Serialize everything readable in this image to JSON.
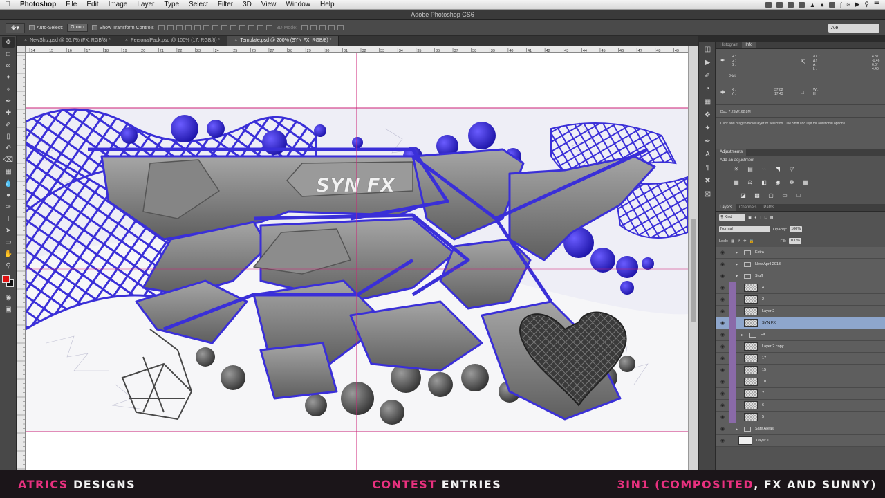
{
  "menubar": {
    "app": "Photoshop",
    "items": [
      "File",
      "Edit",
      "Image",
      "Layer",
      "Type",
      "Select",
      "Filter",
      "3D",
      "View",
      "Window",
      "Help"
    ]
  },
  "window": {
    "title": "Adobe Photoshop CS6"
  },
  "options": {
    "auto_select_label": "Auto-Select:",
    "auto_select_value": "Group",
    "transform_label": "Show Transform Controls",
    "mode_3d": "3D Mode:",
    "workspace": "Ale"
  },
  "tabs": [
    "NewShiz.psd @ 66.7% (FX, RGB/8) *",
    "PersonalPack.psd @ 100% (17, RGB/8) *",
    "Template.psd @ 200% (SYN FX, RGB/8) *"
  ],
  "rulers": {
    "h_ticks": [
      "14",
      "15",
      "16",
      "17",
      "18",
      "19",
      "20",
      "21",
      "22",
      "23",
      "24",
      "25",
      "26",
      "27",
      "28",
      "29",
      "30",
      "31",
      "32",
      "33",
      "34",
      "35",
      "36",
      "37",
      "38",
      "39",
      "40",
      "41",
      "42",
      "43",
      "44",
      "45",
      "46",
      "47",
      "48",
      "49"
    ]
  },
  "artwork": {
    "label": "SYN FX"
  },
  "colors": {
    "accent_blue": "#3a2fd8",
    "guide": "#cc2277",
    "fg": "#e01010",
    "bg": "#111111",
    "banner_pink": "#e8317f"
  },
  "info_panel": {
    "tabs": [
      "Histogram",
      "Info"
    ],
    "rgb_labels": [
      "R :",
      "G :",
      "B :"
    ],
    "bit": "8-bit",
    "delta": {
      "ax_label": "ΔX :",
      "ax": "4.37",
      "ay_label": "ΔY :",
      "ay": "-0.46",
      "a_label": "A :",
      "a": "6.0°",
      "l_label": "L :",
      "l": "4.40"
    },
    "xy": {
      "x_label": "X :",
      "x": "37.82",
      "y_label": "Y :",
      "y": "17.43"
    },
    "wh": {
      "w_label": "W :",
      "h_label": "H :"
    },
    "doc": "Doc: 7.23M/162.8M",
    "hint": "Click and drag to move layer or selection.  Use Shift and Opt for additional options."
  },
  "adjustments": {
    "tab": "Adjustments",
    "header": "Add an adjustment"
  },
  "layers": {
    "tabs": [
      "Layers",
      "Channels",
      "Paths"
    ],
    "kind": "Kind",
    "blend": "Normal",
    "opacity_label": "Opacity:",
    "opacity": "100%",
    "lock_label": "Lock:",
    "fill_label": "Fill:",
    "fill": "100%",
    "rows": [
      {
        "name": "Extra",
        "type": "group",
        "indent": 0
      },
      {
        "name": "New April 2013",
        "type": "group",
        "indent": 0
      },
      {
        "name": "Stuff",
        "type": "group-open",
        "indent": 0
      },
      {
        "name": "4",
        "type": "layer",
        "indent": 1
      },
      {
        "name": "2",
        "type": "layer",
        "indent": 1
      },
      {
        "name": "Layer 2",
        "type": "layer",
        "indent": 1
      },
      {
        "name": "SYN FX",
        "type": "layer",
        "indent": 1,
        "selected": true
      },
      {
        "name": "FX",
        "type": "group",
        "indent": 1
      },
      {
        "name": "Layer 2 copy",
        "type": "layer",
        "indent": 1
      },
      {
        "name": "17",
        "type": "layer",
        "indent": 1
      },
      {
        "name": "15",
        "type": "layer",
        "indent": 1
      },
      {
        "name": "10",
        "type": "layer",
        "indent": 1
      },
      {
        "name": "7",
        "type": "layer",
        "indent": 1
      },
      {
        "name": "6",
        "type": "layer",
        "indent": 1
      },
      {
        "name": "5",
        "type": "layer",
        "indent": 1
      },
      {
        "name": "Safe Areas",
        "type": "group",
        "indent": 0
      },
      {
        "name": "Layer 1",
        "type": "background",
        "indent": 0
      }
    ]
  },
  "banner": {
    "left_pink": "ATRICS",
    "left_white": " DESIGNS",
    "mid_pink": "CONTEST",
    "mid_white": " ENTRIES",
    "right_pink": "3IN1 (COMPOSITED",
    "right_white": ", FX AND SUNNY)"
  }
}
